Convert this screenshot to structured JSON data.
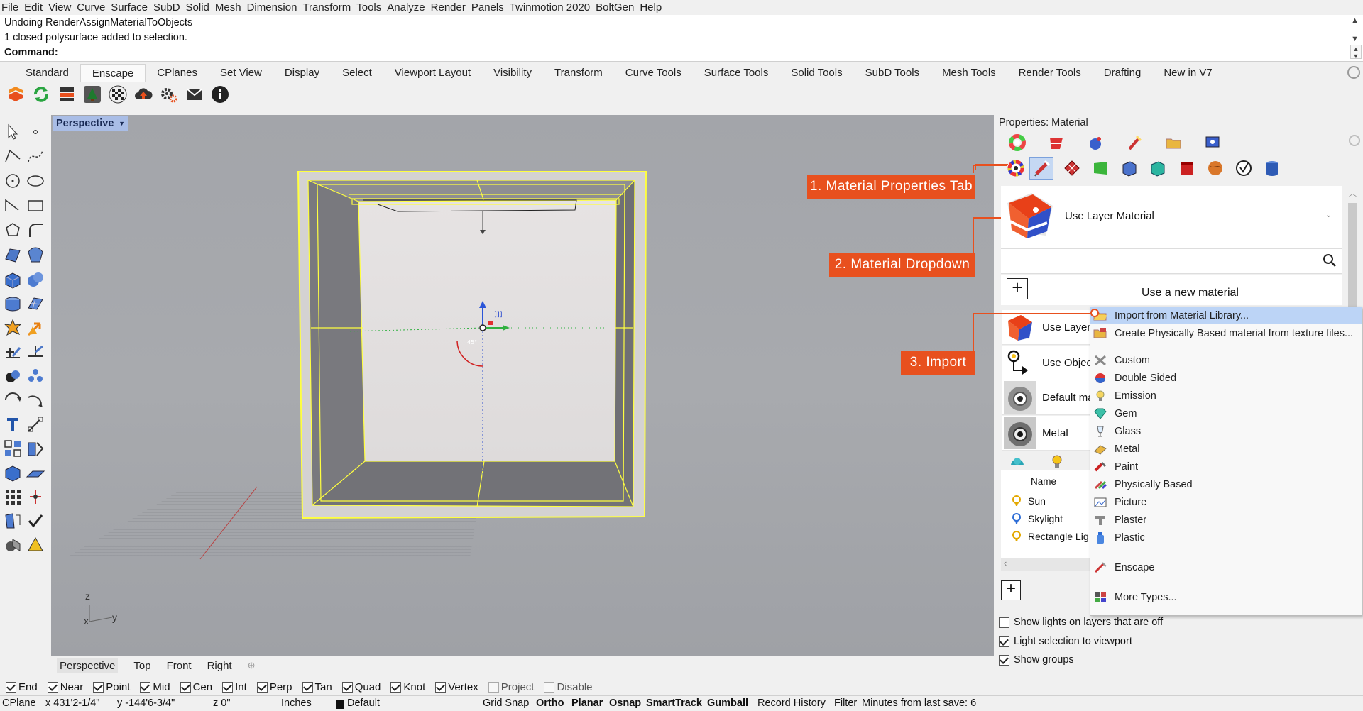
{
  "menu": [
    "File",
    "Edit",
    "View",
    "Curve",
    "Surface",
    "SubD",
    "Solid",
    "Mesh",
    "Dimension",
    "Transform",
    "Tools",
    "Analyze",
    "Render",
    "Panels",
    "Twinmotion 2020",
    "BoltGen",
    "Help"
  ],
  "command": {
    "history_line1": "Undoing RenderAssignMaterialToObjects",
    "history_line2": "1 closed polysurface added to selection.",
    "prompt": "Command:"
  },
  "tabs": [
    "Standard",
    "Enscape",
    "CPlanes",
    "Set View",
    "Display",
    "Select",
    "Viewport Layout",
    "Visibility",
    "Transform",
    "Curve Tools",
    "Surface Tools",
    "Solid Tools",
    "SubD Tools",
    "Mesh Tools",
    "Render Tools",
    "Drafting",
    "New in V7"
  ],
  "active_tab": "Enscape",
  "viewport": {
    "label": "Perspective",
    "axis_z": "z",
    "axis_x": "x",
    "axis_y": "y"
  },
  "view_tabs": [
    "Perspective",
    "Top",
    "Front",
    "Right"
  ],
  "osnaps": [
    {
      "label": "End",
      "checked": true
    },
    {
      "label": "Near",
      "checked": true
    },
    {
      "label": "Point",
      "checked": true
    },
    {
      "label": "Mid",
      "checked": true
    },
    {
      "label": "Cen",
      "checked": true
    },
    {
      "label": "Int",
      "checked": true
    },
    {
      "label": "Perp",
      "checked": true
    },
    {
      "label": "Tan",
      "checked": true
    },
    {
      "label": "Quad",
      "checked": true
    },
    {
      "label": "Knot",
      "checked": true
    },
    {
      "label": "Vertex",
      "checked": true
    },
    {
      "label": "Project",
      "checked": false
    },
    {
      "label": "Disable",
      "checked": false
    }
  ],
  "status": {
    "cplane": "CPlane",
    "x": "x 431'2-1/4\"",
    "y": "y -144'6-3/4\"",
    "z": "z 0\"",
    "units": "Inches",
    "layer": "Default",
    "grid_snap": "Grid Snap",
    "ortho": "Ortho",
    "planar": "Planar",
    "osnap": "Osnap",
    "smarttrack": "SmartTrack",
    "gumball": "Gumball",
    "record_history": "Record History",
    "filter": "Filter",
    "save_info": "Minutes from last save: 6"
  },
  "panel": {
    "title": "Properties: Material",
    "material_name": "Use Layer Material",
    "new_material": "Use a new material",
    "materials": [
      "Use Layer",
      "Use Objec",
      "Default ma",
      "Metal"
    ],
    "lights_header": "Name",
    "lights": [
      "Sun",
      "Skylight",
      "Rectangle Lig"
    ],
    "option_show_lights": "Show lights on layers that are off",
    "option_light_selection": "Light selection to viewport",
    "option_show_groups": "Show groups"
  },
  "callouts": {
    "c1": "1. Material Properties Tab",
    "c2": "2. Material Dropdown",
    "c3": "3. Import"
  },
  "dropdown": {
    "import": "Import from Material Library...",
    "create_pbr": "Create Physically Based material from texture files...",
    "types": [
      "Custom",
      "Double Sided",
      "Emission",
      "Gem",
      "Glass",
      "Metal",
      "Paint",
      "Physically Based",
      "Picture",
      "Plaster",
      "Plastic"
    ],
    "enscape": "Enscape",
    "more": "More Types..."
  },
  "colors": {
    "callout": "#e8501e",
    "viewport_bg": "#a4a6ab",
    "selection": "#ffff40",
    "highlight": "#bcd4f6",
    "vp_label": "#a9bde6"
  }
}
